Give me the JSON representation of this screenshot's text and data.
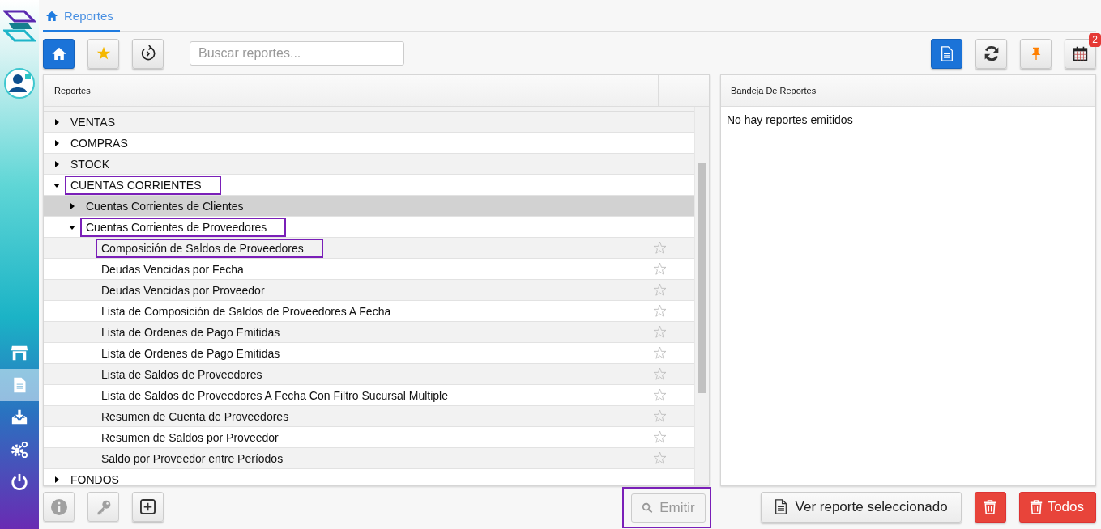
{
  "sidebar": {
    "items": [
      {
        "kind": "store",
        "selected": false
      },
      {
        "kind": "document",
        "selected": true
      },
      {
        "kind": "download",
        "selected": false
      },
      {
        "kind": "gears",
        "selected": false
      },
      {
        "kind": "power",
        "selected": false
      }
    ]
  },
  "tabs": [
    {
      "label": "Reportes",
      "selected": true
    }
  ],
  "toolbar": {
    "left": [
      {
        "kind": "home",
        "selected": true
      },
      {
        "kind": "star",
        "selected": false
      },
      {
        "kind": "history",
        "selected": false
      }
    ],
    "search": {
      "placeholder": "Buscar reportes..."
    },
    "right": [
      {
        "kind": "document",
        "selected": true
      },
      {
        "kind": "refresh",
        "selected": false
      },
      {
        "kind": "pin",
        "selected": false
      },
      {
        "kind": "calendar",
        "selected": false,
        "badge": "2"
      }
    ]
  },
  "tree": {
    "header": "Reportes",
    "items": [
      {
        "label": "VENTAS",
        "expanded": false,
        "selected": false,
        "highlighted": false
      },
      {
        "label": "COMPRAS",
        "expanded": false,
        "selected": false,
        "highlighted": false
      },
      {
        "label": "STOCK",
        "expanded": false,
        "selected": false,
        "highlighted": false
      },
      {
        "label": "CUENTAS CORRIENTES",
        "expanded": true,
        "selected": false,
        "highlighted": true,
        "children": [
          {
            "label": "Cuentas Corrientes de Clientes",
            "expanded": false,
            "selected": true,
            "highlighted": false
          },
          {
            "label": "Cuentas Corrientes de Proveedores",
            "expanded": true,
            "selected": false,
            "highlighted": true,
            "children": [
              {
                "label": "Composición de Saldos de Proveedores",
                "favorite": false,
                "selected": false,
                "highlighted": true
              },
              {
                "label": "Deudas Vencidas por Fecha",
                "favorite": false,
                "selected": false,
                "highlighted": false
              },
              {
                "label": "Deudas Vencidas por Proveedor",
                "favorite": false,
                "selected": false,
                "highlighted": false
              },
              {
                "label": "Lista de Composición de Saldos de Proveedores A Fecha",
                "favorite": false,
                "selected": false,
                "highlighted": false
              },
              {
                "label": "Lista de Ordenes de Pago Emitidas",
                "favorite": false,
                "selected": false,
                "highlighted": false
              },
              {
                "label": "Lista de Ordenes de Pago Emitidas",
                "favorite": false,
                "selected": false,
                "highlighted": false
              },
              {
                "label": "Lista de Saldos de Proveedores",
                "favorite": false,
                "selected": false,
                "highlighted": false
              },
              {
                "label": "Lista de Saldos de Proveedores A Fecha Con Filtro Sucursal Multiple",
                "favorite": false,
                "selected": false,
                "highlighted": false
              },
              {
                "label": "Resumen de Cuenta de Proveedores",
                "favorite": false,
                "selected": false,
                "highlighted": false
              },
              {
                "label": "Resumen de Saldos por Proveedor",
                "favorite": false,
                "selected": false,
                "highlighted": false
              },
              {
                "label": "Saldo por Proveedor entre Períodos",
                "favorite": false,
                "selected": false,
                "highlighted": false
              }
            ]
          }
        ]
      },
      {
        "label": "FONDOS",
        "expanded": false,
        "selected": false,
        "highlighted": false
      }
    ]
  },
  "tree_actions": [
    {
      "kind": "info",
      "disabled": true
    },
    {
      "kind": "key",
      "disabled": true
    },
    {
      "kind": "add",
      "disabled": false
    }
  ],
  "emit_button": {
    "label": "Emitir",
    "disabled": true,
    "highlighted": true
  },
  "tray": {
    "header": "Bandeja De Reportes",
    "message": "No hay reportes emitidos",
    "view_button": "Ver reporte seleccionado",
    "delete_all_button": "Todos"
  }
}
